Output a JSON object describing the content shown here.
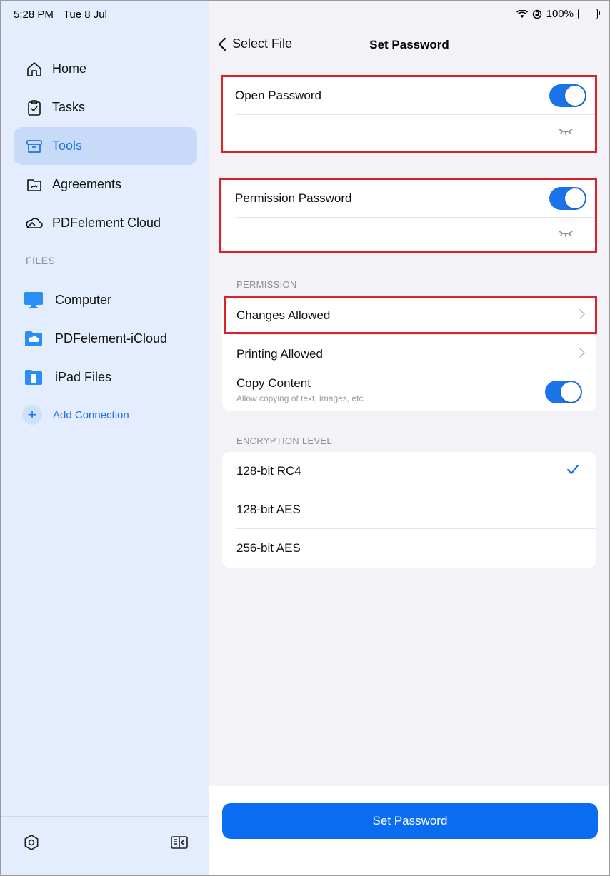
{
  "status_bar": {
    "time": "5:28 PM",
    "date": "Tue 8 Jul",
    "battery": "100%"
  },
  "sidebar": {
    "items": [
      {
        "label": "Home",
        "icon": "home-icon"
      },
      {
        "label": "Tasks",
        "icon": "tasks-icon"
      },
      {
        "label": "Tools",
        "icon": "tools-icon",
        "active": true
      },
      {
        "label": "Agreements",
        "icon": "agreements-icon"
      },
      {
        "label": "PDFelement Cloud",
        "icon": "cloud-icon"
      }
    ],
    "files_header": "FILES",
    "files": [
      {
        "label": "Computer",
        "icon": "computer-icon"
      },
      {
        "label": "PDFelement-iCloud",
        "icon": "icloud-folder-icon"
      },
      {
        "label": "iPad Files",
        "icon": "ipad-files-icon"
      }
    ],
    "add_connection": "Add Connection"
  },
  "header": {
    "back_label": "Select File",
    "title": "Set Password"
  },
  "open_password": {
    "label": "Open Password",
    "enabled": true,
    "value": ""
  },
  "permission_password": {
    "label": "Permission Password",
    "enabled": true,
    "value": ""
  },
  "permission": {
    "header": "PERMISSION",
    "changes_allowed": "Changes Allowed",
    "printing_allowed": "Printing Allowed",
    "copy_content": "Copy Content",
    "copy_content_sub": "Allow copying of text, images, etc.",
    "copy_enabled": true
  },
  "encryption": {
    "header": "ENCRYPTION LEVEL",
    "options": [
      "128-bit RC4",
      "128-bit AES",
      "256-bit AES"
    ],
    "selected": "128-bit RC4"
  },
  "footer": {
    "button": "Set Password"
  },
  "colors": {
    "accent": "#1a73e8",
    "highlight": "#d9232a",
    "sidebar_bg": "#e3edfd"
  }
}
